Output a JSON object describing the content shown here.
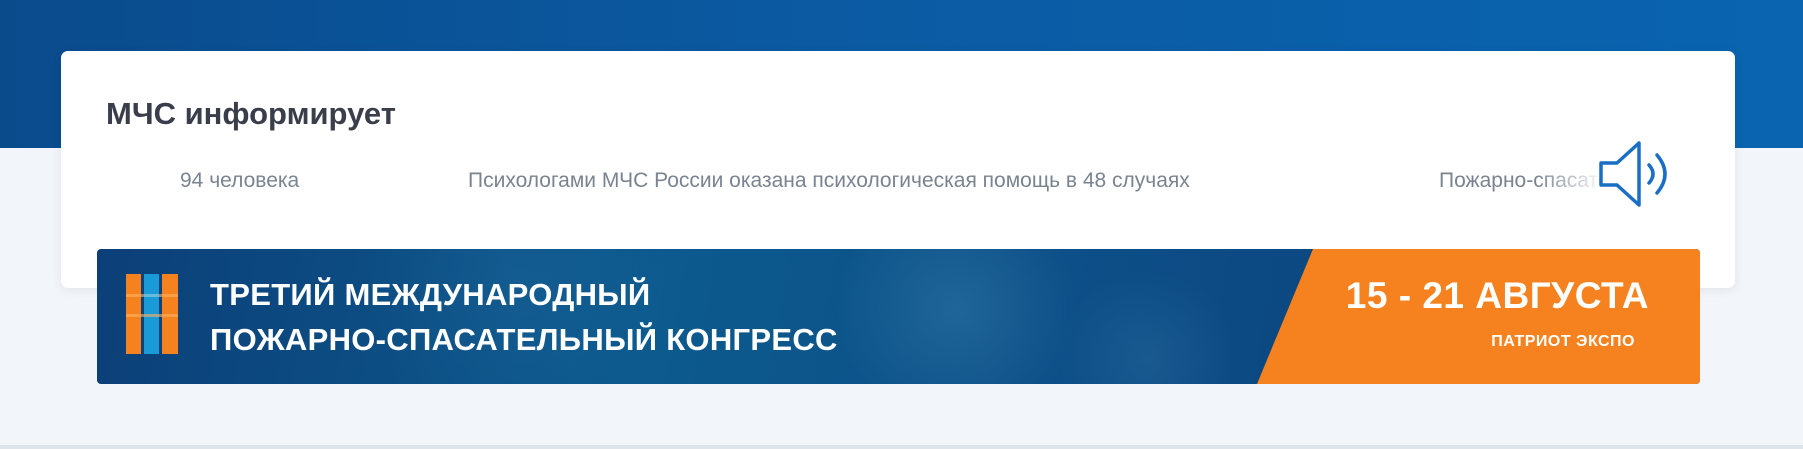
{
  "section": {
    "title": "МЧС информирует"
  },
  "ticker": {
    "items": [
      "94 человека",
      "Психологами МЧС России оказана психологическая помощь в 48 случаях",
      "Пожарно-спасательные"
    ]
  },
  "audio": {
    "icon": "speaker-icon",
    "color": "#1a6fc4"
  },
  "banner": {
    "title_line1": "ТРЕТИЙ МЕЖДУНАРОДНЫЙ",
    "title_line2": "ПОЖАРНО-СПАСАТЕЛЬНЫЙ КОНГРЕСС",
    "dates": "15 - 21 АВГУСТА",
    "venue": "ПАТРИОТ ЭКСПО",
    "logo_icon": "congress-logo-icon",
    "accent_color": "#f5821f",
    "background_color": "#0c4a85"
  },
  "colors": {
    "header_band": "#0b5aa2",
    "page_background": "#f2f5f9",
    "card_title": "#3a3e4b",
    "ticker_text": "#7a8491"
  }
}
